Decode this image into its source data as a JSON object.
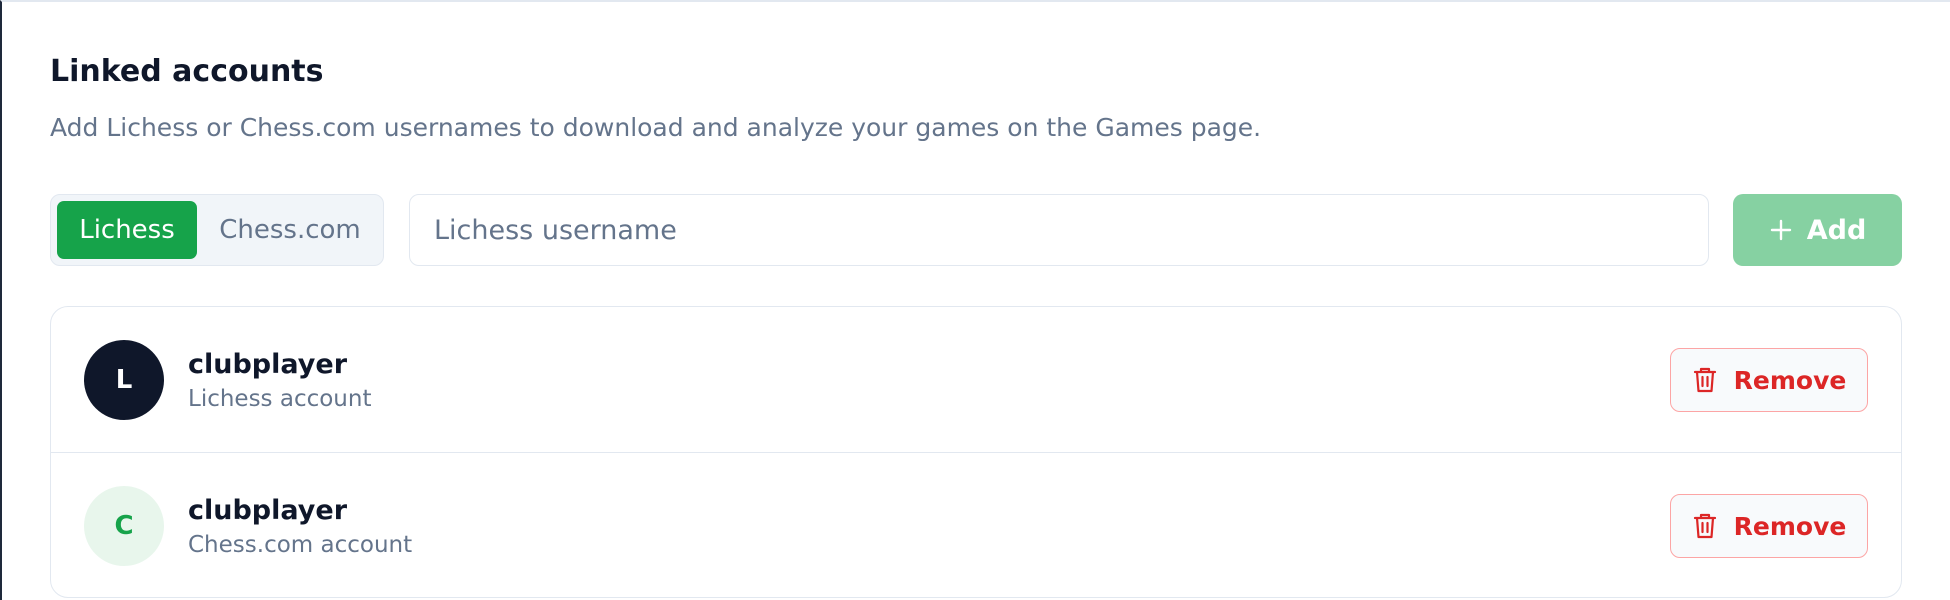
{
  "linked_accounts": {
    "title": "Linked accounts",
    "description": "Add Lichess or Chess.com usernames to download and analyze your games on the Games page."
  },
  "platform_toggle": {
    "options": [
      {
        "label": "Lichess",
        "selected": true
      },
      {
        "label": "Chess.com",
        "selected": false
      }
    ]
  },
  "username_input": {
    "placeholder": "Lichess username",
    "value": ""
  },
  "add_button": {
    "label": "Add",
    "icon": "plus-icon"
  },
  "accounts": [
    {
      "avatar_letter": "L",
      "username": "clubplayer",
      "type_label": "Lichess account",
      "remove_label": "Remove"
    },
    {
      "avatar_letter": "C",
      "username": "clubplayer",
      "type_label": "Chess.com account",
      "remove_label": "Remove"
    }
  ],
  "colors": {
    "accent_green": "#16a34a",
    "add_button_disabled": "#86d1a2",
    "danger_red": "#dc2626",
    "danger_border": "#fca5a5",
    "muted_text": "#64748b",
    "dark_avatar": "#0f172a",
    "light_avatar": "#e8f6ec"
  }
}
